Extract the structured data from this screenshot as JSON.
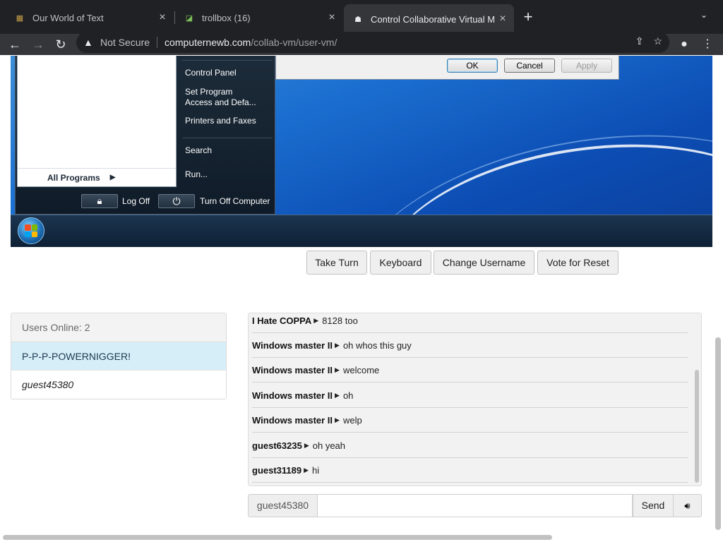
{
  "browser": {
    "tabs": [
      {
        "title": "Our World of Text",
        "active": false
      },
      {
        "title": "trollbox (16)",
        "active": false
      },
      {
        "title": "Control Collaborative Virtual M",
        "active": true
      }
    ],
    "address": {
      "security_label": "Not Secure",
      "host": "computernewb.com",
      "path": "/collab-vm/user-vm/"
    }
  },
  "vm": {
    "dialog": {
      "ok": "OK",
      "cancel": "Cancel",
      "apply": "Apply"
    },
    "start_menu": {
      "right_items": [
        "Control Panel",
        "Set Program\nAccess and Defa...",
        "Printers and Faxes",
        "Search",
        "Run..."
      ],
      "all_programs": "All Programs",
      "log_off": "Log Off",
      "turn_off": "Turn Off Computer"
    }
  },
  "controls": {
    "take_turn": "Take Turn",
    "keyboard": "Keyboard",
    "change_username": "Change Username",
    "vote_reset": "Vote for Reset"
  },
  "users": {
    "header": "Users Online: 2",
    "list": [
      {
        "name": "P-P-P-POWERNIGGER!",
        "highlighted": true
      },
      {
        "name": "guest45380",
        "self": true
      }
    ]
  },
  "chat": {
    "messages": [
      {
        "user": "I Hate COPPA",
        "text": "8128 too"
      },
      {
        "user": "Windows master II",
        "text": "oh whos this guy"
      },
      {
        "user": "Windows master II",
        "text": "welcome"
      },
      {
        "user": "Windows master II",
        "text": "oh"
      },
      {
        "user": "Windows master II",
        "text": "welp"
      },
      {
        "user": "guest63235",
        "text": "oh yeah"
      },
      {
        "user": "guest31189",
        "text": "hi"
      }
    ],
    "username": "guest45380",
    "input_value": "",
    "send": "Send"
  },
  "colors": {
    "highlight_row": "#d6eef8",
    "chrome_dark": "#202124",
    "vm_blue": "#1b6fd0"
  }
}
